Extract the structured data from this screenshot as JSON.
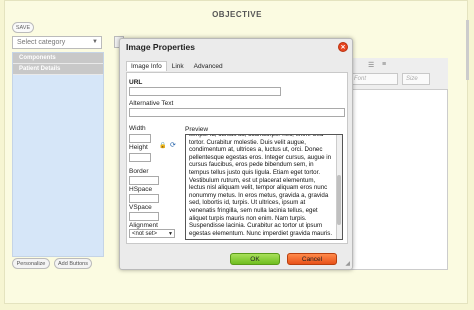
{
  "app": {
    "title": "OBJECTIVE",
    "save_label": "SAVE",
    "category_placeholder": "Select category",
    "sidebar_items": [
      "Components",
      "Patient Details"
    ],
    "personalize_label": "Personalize",
    "add_buttons_label": "Add Buttons",
    "font_placeholder": "Font",
    "size_placeholder": "Size"
  },
  "dialog": {
    "title": "Image Properties",
    "tabs": [
      "Image Info",
      "Link",
      "Advanced"
    ],
    "active_tab": "Image Info",
    "url_label": "URL",
    "url_value": "",
    "alt_label": "Alternative Text",
    "alt_value": "",
    "width_label": "Width",
    "height_label": "Height",
    "border_label": "Border",
    "hspace_label": "HSpace",
    "vspace_label": "VSpace",
    "alignment_label": "Alignment",
    "alignment_value": "<not set>",
    "preview_label": "Preview",
    "preview_text": "tempor id, cursus ac, ullamcorper nec, enim. Sed tortor. Curabitur molestie. Duis velit augue, condimentum at, ultrices a, luctus ut, orci. Donec pellentesque egestas eros. Integer cursus, augue in cursus faucibus, eros pede bibendum sem, in tempus tellus justo quis ligula. Etiam eget tortor. Vestibulum rutrum, est ut placerat elementum, lectus nisl aliquam velit, tempor aliquam eros nunc nonummy metus. In eros metus, gravida a, gravida sed, lobortis id, turpis. Ut ultrices, ipsum at venenatis fringilla, sem nulla lacinia tellus, eget aliquet turpis mauris non enim. Nam turpis. Suspendisse lacinia. Curabitur ac tortor ut ipsum egestas elementum. Nunc imperdiet gravida mauris.",
    "ok_label": "OK",
    "cancel_label": "Cancel"
  },
  "colors": {
    "ok": "#7fcf2c",
    "cancel": "#f06a2c",
    "close": "#e8451f"
  }
}
